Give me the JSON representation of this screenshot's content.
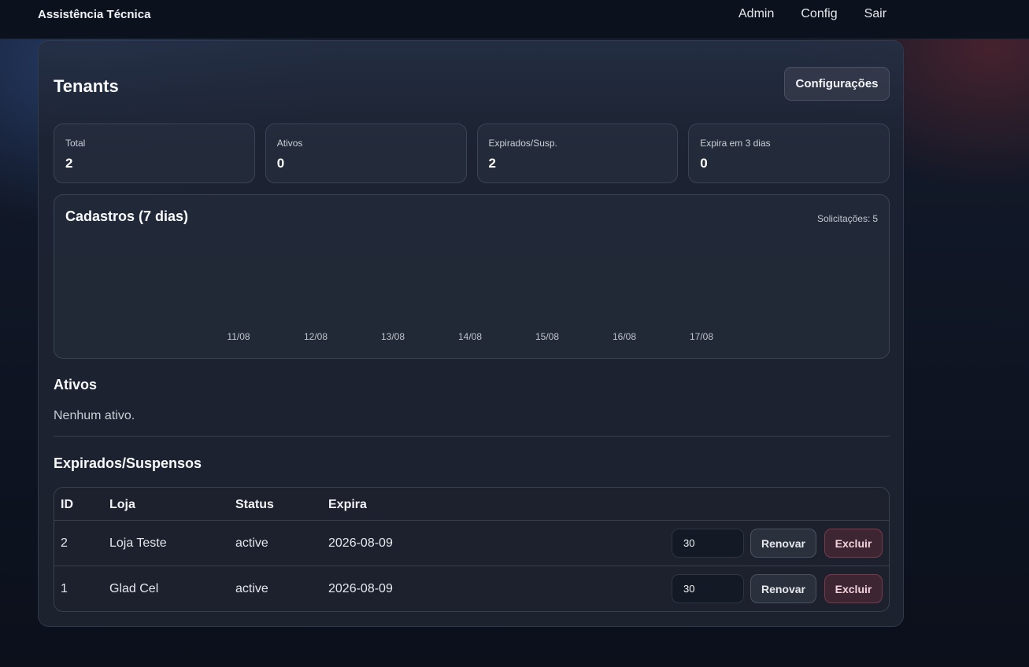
{
  "app": {
    "brand": "Assistência Técnica",
    "nav": [
      "Admin",
      "Config",
      "Sair"
    ]
  },
  "page": {
    "title": "Tenants",
    "config_button": "Configurações"
  },
  "stats": [
    {
      "label": "Total",
      "value": "2"
    },
    {
      "label": "Ativos",
      "value": "0"
    },
    {
      "label": "Expirados/Susp.",
      "value": "2"
    },
    {
      "label": "Expira em 3 dias",
      "value": "0"
    }
  ],
  "chart_data": {
    "type": "bar",
    "title": "Cadastros (7 dias)",
    "requests_label": "Solicitações:",
    "requests_value": "5",
    "categories": [
      "11/08",
      "12/08",
      "13/08",
      "14/08",
      "15/08",
      "16/08",
      "17/08"
    ],
    "values": [
      0,
      0,
      0,
      0,
      0,
      0,
      0
    ],
    "xlabel": "",
    "ylabel": "",
    "grid": false
  },
  "active_section": {
    "title": "Ativos",
    "empty_text": "Nenhum ativo."
  },
  "expired_section": {
    "title": "Expirados/Suspensos",
    "columns": [
      "ID",
      "Loja",
      "Status",
      "Expira"
    ],
    "rows": [
      {
        "id": "2",
        "store": "Loja Teste",
        "status": "active",
        "expires": "2026-08-09",
        "days": "30",
        "renew_label": "Renovar",
        "delete_label": "Excluir"
      },
      {
        "id": "1",
        "store": "Glad Cel",
        "status": "active",
        "expires": "2026-08-09",
        "days": "30",
        "renew_label": "Renovar",
        "delete_label": "Excluir"
      }
    ]
  }
}
